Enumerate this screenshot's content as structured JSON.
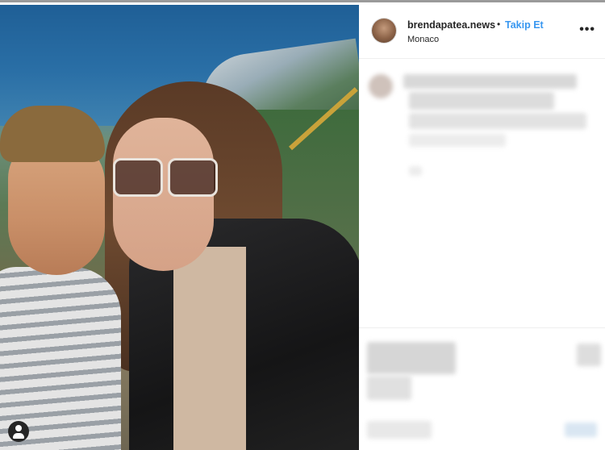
{
  "post": {
    "username": "brendapatea.news",
    "separator": "•",
    "follow_label": "Takip Et",
    "location": "Monaco",
    "more_label": "•••"
  },
  "icons": {
    "avatar": "profile-avatar",
    "more": "more-options-icon",
    "tagged_user": "user-tag-icon"
  },
  "colors": {
    "follow": "#3897f0",
    "text": "#262626",
    "border": "#efefef"
  }
}
